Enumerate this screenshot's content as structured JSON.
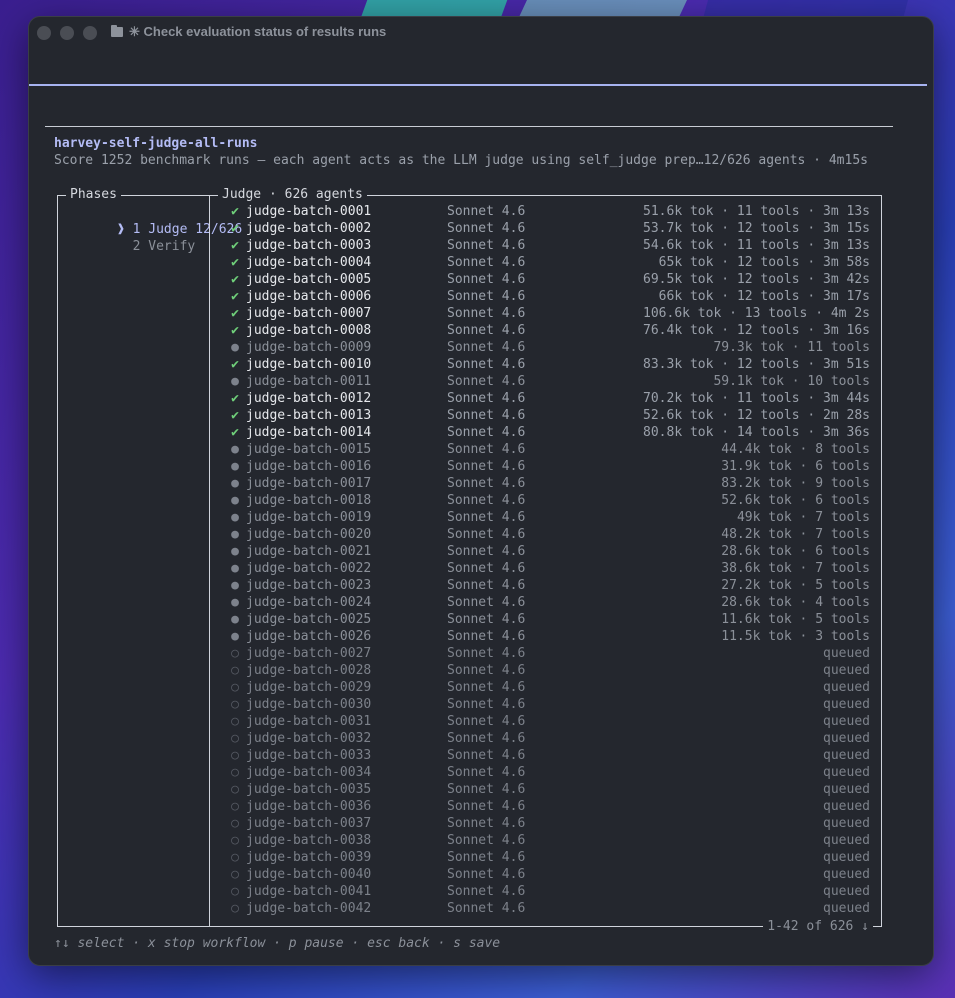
{
  "window": {
    "title": "✳ Check evaluation status of results runs"
  },
  "workflow": {
    "name": "harvey-self-judge-all-runs",
    "description": "Score 1252 benchmark runs — each agent acts as the LLM judge using self_judge prep…12/626 agents · 4m15s"
  },
  "phases": {
    "title": "Phases",
    "items": [
      {
        "marker": "❱",
        "label": "1 Judge 12/626",
        "active": true
      },
      {
        "marker": " ",
        "label": "2 Verify",
        "active": false
      }
    ]
  },
  "judge": {
    "title": "Judge · 626 agents",
    "pager": "1-42 of 626 ↓",
    "rows": [
      {
        "status": "done",
        "icon": "✔",
        "name": "judge-batch-0001",
        "model": "Sonnet 4.6",
        "stats": "51.6k tok · 11 tools · 3m 13s"
      },
      {
        "status": "done",
        "icon": "✔",
        "name": "judge-batch-0002",
        "model": "Sonnet 4.6",
        "stats": "53.7k tok · 12 tools · 3m 15s"
      },
      {
        "status": "done",
        "icon": "✔",
        "name": "judge-batch-0003",
        "model": "Sonnet 4.6",
        "stats": "54.6k tok · 11 tools · 3m 13s"
      },
      {
        "status": "done",
        "icon": "✔",
        "name": "judge-batch-0004",
        "model": "Sonnet 4.6",
        "stats": "65k tok · 12 tools · 3m 58s"
      },
      {
        "status": "done",
        "icon": "✔",
        "name": "judge-batch-0005",
        "model": "Sonnet 4.6",
        "stats": "69.5k tok · 12 tools · 3m 42s"
      },
      {
        "status": "done",
        "icon": "✔",
        "name": "judge-batch-0006",
        "model": "Sonnet 4.6",
        "stats": "66k tok · 12 tools · 3m 17s"
      },
      {
        "status": "done",
        "icon": "✔",
        "name": "judge-batch-0007",
        "model": "Sonnet 4.6",
        "stats": "106.6k tok · 13 tools · 4m 2s"
      },
      {
        "status": "done",
        "icon": "✔",
        "name": "judge-batch-0008",
        "model": "Sonnet 4.6",
        "stats": "76.4k tok · 12 tools · 3m 16s"
      },
      {
        "status": "run",
        "icon": "●",
        "name": "judge-batch-0009",
        "model": "Sonnet 4.6",
        "stats": "79.3k tok · 11 tools"
      },
      {
        "status": "done",
        "icon": "✔",
        "name": "judge-batch-0010",
        "model": "Sonnet 4.6",
        "stats": "83.3k tok · 12 tools · 3m 51s"
      },
      {
        "status": "run",
        "icon": "●",
        "name": "judge-batch-0011",
        "model": "Sonnet 4.6",
        "stats": "59.1k tok · 10 tools"
      },
      {
        "status": "done",
        "icon": "✔",
        "name": "judge-batch-0012",
        "model": "Sonnet 4.6",
        "stats": "70.2k tok · 11 tools · 3m 44s"
      },
      {
        "status": "done",
        "icon": "✔",
        "name": "judge-batch-0013",
        "model": "Sonnet 4.6",
        "stats": "52.6k tok · 12 tools · 2m 28s"
      },
      {
        "status": "done",
        "icon": "✔",
        "name": "judge-batch-0014",
        "model": "Sonnet 4.6",
        "stats": "80.8k tok · 14 tools · 3m 36s"
      },
      {
        "status": "run",
        "icon": "●",
        "name": "judge-batch-0015",
        "model": "Sonnet 4.6",
        "stats": "44.4k tok · 8 tools"
      },
      {
        "status": "run",
        "icon": "●",
        "name": "judge-batch-0016",
        "model": "Sonnet 4.6",
        "stats": "31.9k tok · 6 tools"
      },
      {
        "status": "run",
        "icon": "●",
        "name": "judge-batch-0017",
        "model": "Sonnet 4.6",
        "stats": "83.2k tok · 9 tools"
      },
      {
        "status": "run",
        "icon": "●",
        "name": "judge-batch-0018",
        "model": "Sonnet 4.6",
        "stats": "52.6k tok · 6 tools"
      },
      {
        "status": "run",
        "icon": "●",
        "name": "judge-batch-0019",
        "model": "Sonnet 4.6",
        "stats": "49k tok · 7 tools"
      },
      {
        "status": "run",
        "icon": "●",
        "name": "judge-batch-0020",
        "model": "Sonnet 4.6",
        "stats": "48.2k tok · 7 tools"
      },
      {
        "status": "run",
        "icon": "●",
        "name": "judge-batch-0021",
        "model": "Sonnet 4.6",
        "stats": "28.6k tok · 6 tools"
      },
      {
        "status": "run",
        "icon": "●",
        "name": "judge-batch-0022",
        "model": "Sonnet 4.6",
        "stats": "38.6k tok · 7 tools"
      },
      {
        "status": "run",
        "icon": "●",
        "name": "judge-batch-0023",
        "model": "Sonnet 4.6",
        "stats": "27.2k tok · 5 tools"
      },
      {
        "status": "run",
        "icon": "●",
        "name": "judge-batch-0024",
        "model": "Sonnet 4.6",
        "stats": "28.6k tok · 4 tools"
      },
      {
        "status": "run",
        "icon": "●",
        "name": "judge-batch-0025",
        "model": "Sonnet 4.6",
        "stats": "11.6k tok · 5 tools"
      },
      {
        "status": "run",
        "icon": "●",
        "name": "judge-batch-0026",
        "model": "Sonnet 4.6",
        "stats": "11.5k tok · 3 tools"
      },
      {
        "status": "q",
        "icon": "○",
        "name": "judge-batch-0027",
        "model": "Sonnet 4.6",
        "stats": "queued"
      },
      {
        "status": "q",
        "icon": "○",
        "name": "judge-batch-0028",
        "model": "Sonnet 4.6",
        "stats": "queued"
      },
      {
        "status": "q",
        "icon": "○",
        "name": "judge-batch-0029",
        "model": "Sonnet 4.6",
        "stats": "queued"
      },
      {
        "status": "q",
        "icon": "○",
        "name": "judge-batch-0030",
        "model": "Sonnet 4.6",
        "stats": "queued"
      },
      {
        "status": "q",
        "icon": "○",
        "name": "judge-batch-0031",
        "model": "Sonnet 4.6",
        "stats": "queued"
      },
      {
        "status": "q",
        "icon": "○",
        "name": "judge-batch-0032",
        "model": "Sonnet 4.6",
        "stats": "queued"
      },
      {
        "status": "q",
        "icon": "○",
        "name": "judge-batch-0033",
        "model": "Sonnet 4.6",
        "stats": "queued"
      },
      {
        "status": "q",
        "icon": "○",
        "name": "judge-batch-0034",
        "model": "Sonnet 4.6",
        "stats": "queued"
      },
      {
        "status": "q",
        "icon": "○",
        "name": "judge-batch-0035",
        "model": "Sonnet 4.6",
        "stats": "queued"
      },
      {
        "status": "q",
        "icon": "○",
        "name": "judge-batch-0036",
        "model": "Sonnet 4.6",
        "stats": "queued"
      },
      {
        "status": "q",
        "icon": "○",
        "name": "judge-batch-0037",
        "model": "Sonnet 4.6",
        "stats": "queued"
      },
      {
        "status": "q",
        "icon": "○",
        "name": "judge-batch-0038",
        "model": "Sonnet 4.6",
        "stats": "queued"
      },
      {
        "status": "q",
        "icon": "○",
        "name": "judge-batch-0039",
        "model": "Sonnet 4.6",
        "stats": "queued"
      },
      {
        "status": "q",
        "icon": "○",
        "name": "judge-batch-0040",
        "model": "Sonnet 4.6",
        "stats": "queued"
      },
      {
        "status": "q",
        "icon": "○",
        "name": "judge-batch-0041",
        "model": "Sonnet 4.6",
        "stats": "queued"
      },
      {
        "status": "q",
        "icon": "○",
        "name": "judge-batch-0042",
        "model": "Sonnet 4.6",
        "stats": "queued"
      }
    ]
  },
  "footer": {
    "hint": "↑↓ select · x stop workflow · p pause · esc back · s save"
  }
}
